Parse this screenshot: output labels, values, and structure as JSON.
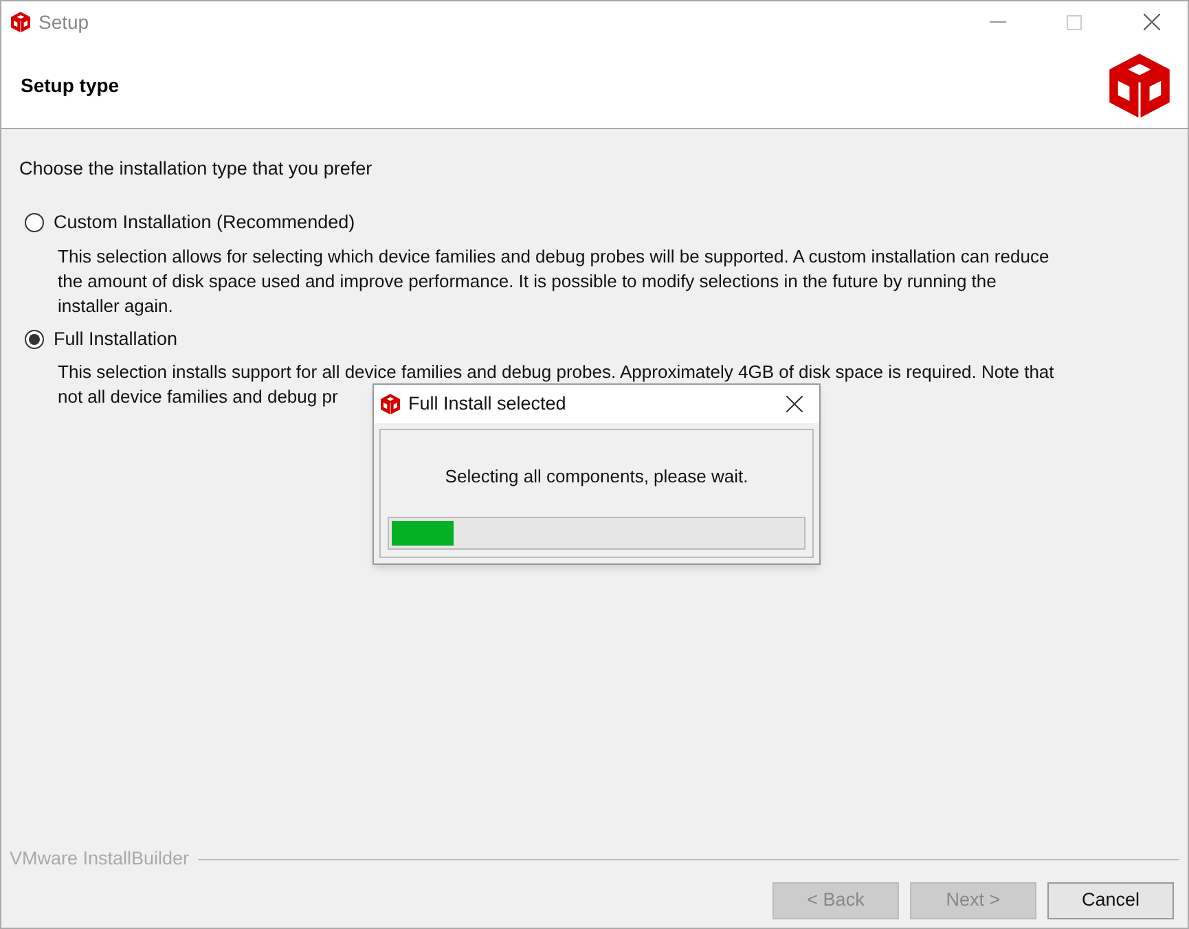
{
  "window": {
    "title": "Setup"
  },
  "header": {
    "title": "Setup type"
  },
  "prompt": "Choose the installation type that you prefer",
  "options": [
    {
      "label": "Custom Installation (Recommended)",
      "selected": false,
      "description": [
        "This selection allows for selecting which device families and debug probes will be supported.  A custom installation can reduce",
        "the amount of disk space used and improve performance.  It is possible to modify selections in the future by running the",
        "installer again."
      ]
    },
    {
      "label": "Full Installation",
      "selected": true,
      "description": [
        "This selection installs support for all device families and debug probes.  Approximately 4GB of disk space is required.  Note that",
        "not all device families and debug pr"
      ]
    }
  ],
  "dialog": {
    "title": "Full Install selected",
    "message": "Selecting all components, please wait.",
    "level": 0.15
  },
  "footer": {
    "brand": "VMware InstallBuilder",
    "buttons": [
      {
        "label": "< Back",
        "disabled": true
      },
      {
        "label": "Next >",
        "disabled": true
      },
      {
        "label": "Cancel",
        "disabled": false
      }
    ]
  }
}
